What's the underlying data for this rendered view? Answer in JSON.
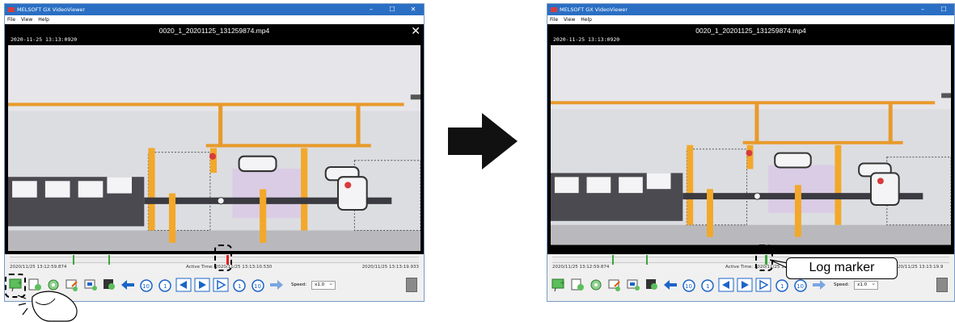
{
  "screens": [
    {
      "app_title": "MELSOFT GX VideoViewer",
      "menu": [
        "File",
        "View",
        "Help"
      ],
      "video_filename": "0020_1_20201125_131259874.mp4",
      "video_timestamp": "2020-11-25  13:13:0920",
      "start_time": "2020/11/25  13:12:59.874",
      "active_time": "Active Time: 2020/11/25  13:13:10.530",
      "end_time": "2020/11/25  13:13:19.933",
      "speed_label": "Speed:",
      "speed_value": "x1.0"
    },
    {
      "app_title": "MELSOFT GX VideoViewer",
      "menu": [
        "File",
        "View",
        "Help"
      ],
      "video_filename": "0020_1_20201125_131259874.mp4",
      "video_timestamp": "2020-11-25  13:13:0920",
      "start_time": "2020/11/25  13:12:59.874",
      "active_time": "Active Time: 2020/11/25  13:1",
      "end_time": "2020/11/25  13:13:19.9",
      "speed_label": "Speed:",
      "speed_value": "x1.0"
    }
  ],
  "callout_label": "Log marker",
  "colors": {
    "titlebar": "#2a6fc4",
    "marker_green": "#3aa63a",
    "marker_red": "#e02020",
    "orange": "#f2a82a",
    "nav_blue": "#1b64c8"
  }
}
